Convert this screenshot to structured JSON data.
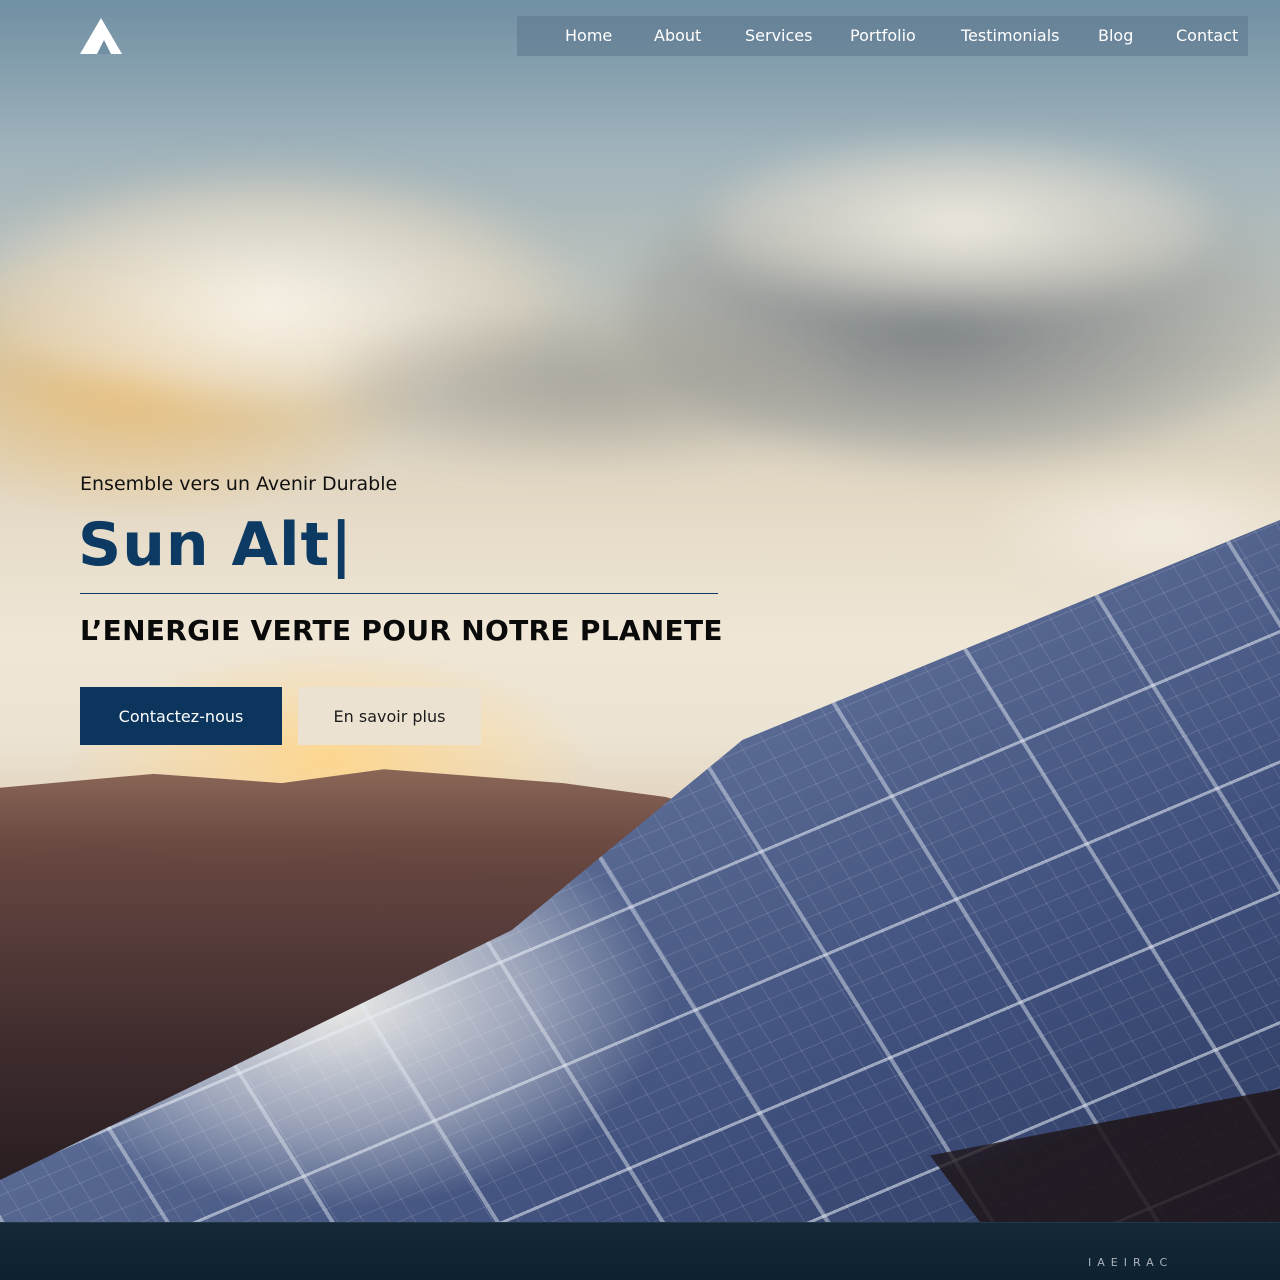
{
  "header": {
    "logo_icon": "triangle-logo-icon",
    "nav": [
      {
        "label": "Home"
      },
      {
        "label": "About"
      },
      {
        "label": "Services"
      },
      {
        "label": "Portfolio"
      },
      {
        "label": "Testimonials"
      },
      {
        "label": "Blog"
      },
      {
        "label": "Contact"
      }
    ]
  },
  "hero": {
    "tagline": "Ensemble vers un Avenir Durable",
    "brand": "Sun Alt|",
    "headline": "L’ENERGIE VERTE POUR NOTRE PLANETE",
    "primary_button": "Contactez-nous",
    "secondary_button": "En savoir plus"
  },
  "footer": {
    "mark": "IAEIRAC"
  },
  "colors": {
    "brand_blue": "#0b355d",
    "secondary_button_bg": "#ece2d2",
    "nav_bg": "#5c768c"
  }
}
